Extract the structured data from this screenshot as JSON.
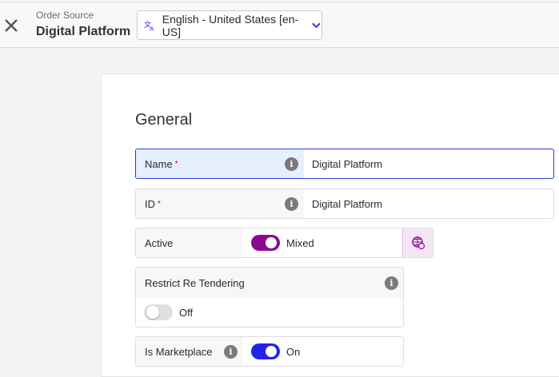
{
  "header": {
    "subtitle": "Order Source",
    "title": "Digital Platform",
    "language": "English - United States [en-US]"
  },
  "section": {
    "title": "General"
  },
  "fields": {
    "name": {
      "label": "Name",
      "required": "*",
      "value": "Digital Platform"
    },
    "id": {
      "label": "ID",
      "required": "*",
      "value": "Digital Platform"
    },
    "active": {
      "label": "Active",
      "state": "Mixed"
    },
    "restrict": {
      "label": "Restrict Re Tendering",
      "state": "Off"
    },
    "marketplace": {
      "label": "Is Marketplace",
      "state": "On"
    }
  },
  "colors": {
    "accent": "#2323e8",
    "mixed": "#8b0a8f",
    "focus_border": "#2b3bd9"
  },
  "icons": {
    "info": "i"
  }
}
